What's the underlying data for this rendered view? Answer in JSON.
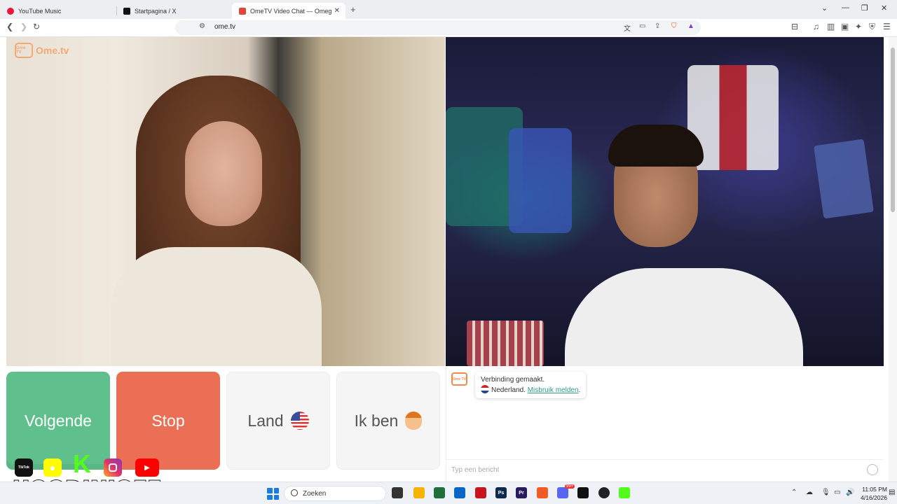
{
  "browser": {
    "tabs": [
      {
        "title": "YouTube Music",
        "active": false
      },
      {
        "title": "Startpagina / X",
        "active": false
      },
      {
        "title": "OmeTV Video Chat — Omeg",
        "active": true
      }
    ],
    "url": "ome.tv"
  },
  "app": {
    "logo_text": "Ome.tv",
    "logo_badge": "Ome TV"
  },
  "controls": {
    "next_label": "Volgende",
    "stop_label": "Stop",
    "country_label": "Land",
    "gender_label": "Ik ben"
  },
  "chat": {
    "status": "Verbinding gemaakt.",
    "country": "Nederland.",
    "report_link": "Misbruik melden",
    "report_suffix": ".",
    "input_placeholder": "Typ een bericht"
  },
  "overlay": {
    "channel_name": "HOODINIOFF",
    "social_icons": [
      "tiktok-icon",
      "snapchat-icon",
      "kick-icon",
      "instagram-icon",
      "youtube-icon"
    ],
    "tiktok_label": "TikTok",
    "kick_letter": "K"
  },
  "taskbar": {
    "search_placeholder": "Zoeken",
    "time": "11:05 PM",
    "date": "4/16/2026",
    "notification_badge": "99+"
  },
  "colors": {
    "next": "#5fc08d",
    "stop": "#ea6f55",
    "link": "#2c9a8c",
    "brand": "#f08a4b"
  }
}
